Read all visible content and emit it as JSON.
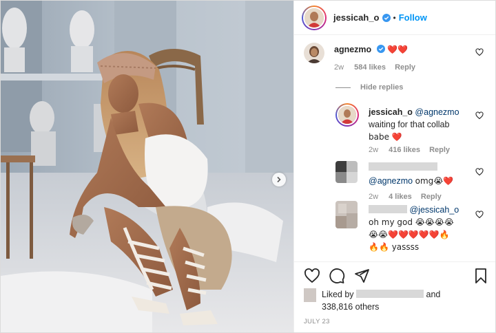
{
  "post": {
    "author": "jessicah_o",
    "follow_label": "Follow",
    "separator": "•",
    "colors": {
      "accent": "#0095f6",
      "heart": "#ed4956",
      "muted": "#8e8e8e"
    }
  },
  "comments": {
    "first": {
      "user": "agnezmo",
      "text": "❤️❤️",
      "age": "2w",
      "likes": "584 likes",
      "reply_label": "Reply"
    },
    "hide_replies_label": "Hide replies",
    "reply1": {
      "user": "jessicah_o",
      "mention": "@agnezmo",
      "text_line1": "waiting for that collab",
      "text_line2": "babe ❤️",
      "age": "2w",
      "likes": "416 likes",
      "reply_label": "Reply"
    },
    "reply2": {
      "mention": "@agnezmo",
      "text": "omg😭❤️",
      "age": "2w",
      "likes": "4 likes",
      "reply_label": "Reply"
    },
    "reply3": {
      "mention": "@jessicah_o",
      "line1": "oh my god 😭😭😭😭",
      "line2": "😭😭❤️❤️❤️❤️❤️🔥",
      "line3": "🔥🔥 yassss"
    }
  },
  "footer": {
    "liked_by_prefix": "Liked by",
    "liked_by_and": "and",
    "others": "338,816 others",
    "date": "JULY 23"
  },
  "icons": [
    "heart-icon",
    "comment-icon",
    "share-icon",
    "bookmark-icon",
    "verified-badge-icon",
    "chevron-right-icon"
  ]
}
